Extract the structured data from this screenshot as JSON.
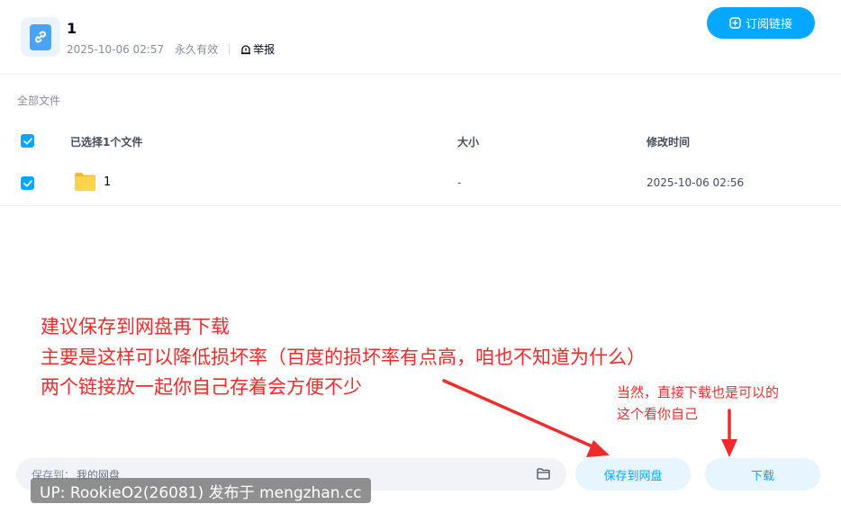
{
  "share": {
    "title": "1",
    "date": "2025-10-06 02:57",
    "validity": "永久有效",
    "report_label": "举报",
    "subscribe_label": "订阅链接"
  },
  "breadcrumb": "全部文件",
  "table": {
    "header_name": "已选择1个文件",
    "header_size": "大小",
    "header_modified": "修改时间",
    "rows": [
      {
        "name": "1",
        "size": "-",
        "modified": "2025-10-06 02:56",
        "selected": true
      }
    ]
  },
  "footer": {
    "save_path_label": "保存到：",
    "save_path_value": "我的网盘",
    "save_button": "保存到网盘",
    "download_button": "下载"
  },
  "annotations": {
    "line1": "建议保存到网盘再下载",
    "line2": "主要是这样可以降低损坏率（百度的损坏率有点高，咱也不知道为什么）",
    "line3": "两个链接放一起你自己存着会方便不少",
    "note1": "当然，直接下载也是可以的",
    "note2": "这个看你自己"
  },
  "watermark": "UP: RookieO2(26081) 发布于 mengzhan.cc",
  "colors": {
    "accent": "#06a7ff",
    "annotation": "#f02b2b"
  }
}
